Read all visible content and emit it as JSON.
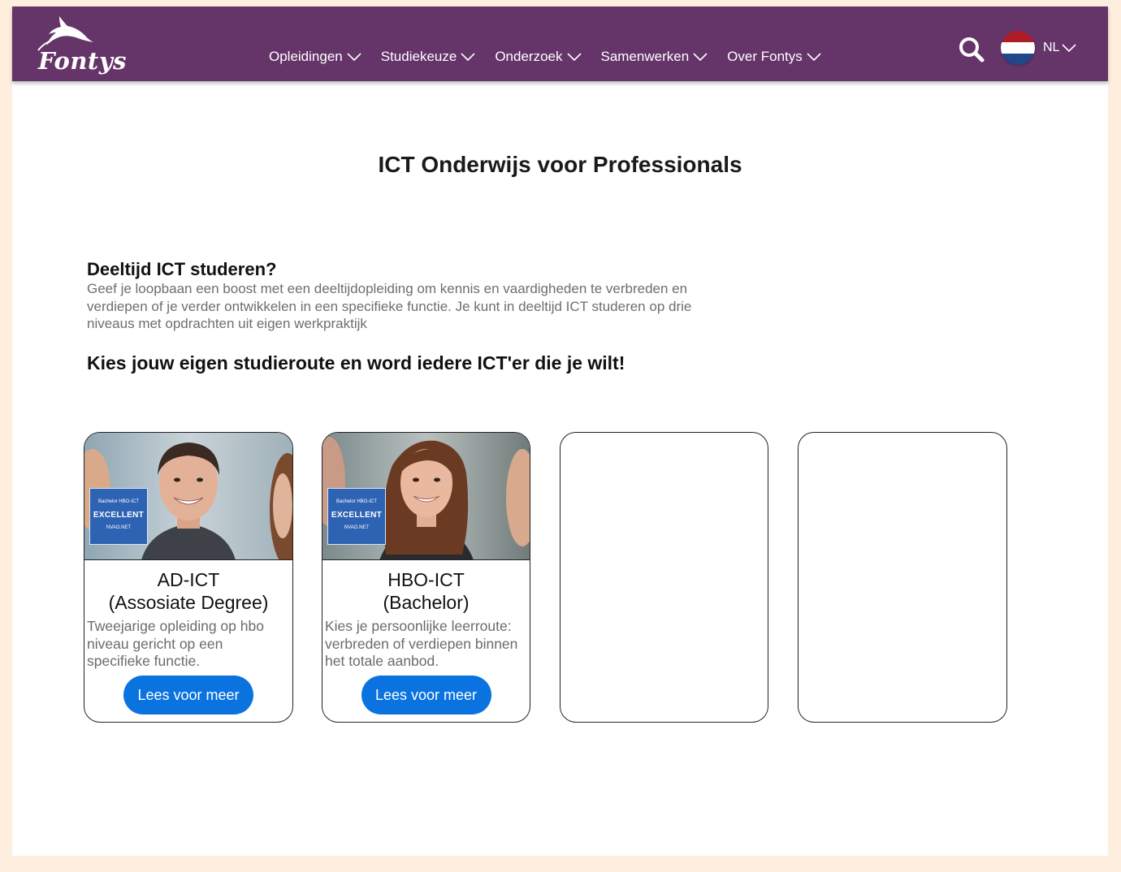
{
  "brand": {
    "name": "Fontys"
  },
  "nav": {
    "items": [
      {
        "label": "Opleidingen"
      },
      {
        "label": "Studiekeuze"
      },
      {
        "label": "Onderzoek"
      },
      {
        "label": "Samenwerken"
      },
      {
        "label": "Over Fontys"
      }
    ],
    "language": "NL"
  },
  "hero": {
    "title": "ICT Onderwijs voor Professionals"
  },
  "intro": {
    "heading": "Deeltijd ICT studeren?",
    "text": "Geef je loopbaan een boost met een deeltijdopleiding om kennis en vaardigheden te verbreden en verdiepen of je verder ontwikkelen in een specifieke functie. Je kunt in deeltijd ICT studeren op drie niveaus met opdrachten uit eigen werkpraktijk"
  },
  "route_heading": "Kies jouw eigen studieroute en word iedere ICT'er die je wilt!",
  "cards": [
    {
      "title_line1": "AD-ICT",
      "title_line2": "(Assosiate Degree)",
      "description": "Tweejarige opleiding op hbo niveau gericht op een specifieke functie.",
      "button": "Lees voor meer",
      "badge": {
        "line1": "Bachelor HBO-ICT",
        "line2": "EXCELLENT",
        "line3": "NVAO.NET"
      }
    },
    {
      "title_line1": "HBO-ICT",
      "title_line2": "(Bachelor)",
      "description": "Kies je persoonlijke leerroute: verbreden of verdiepen binnen het totale aanbod.",
      "button": "Lees voor meer",
      "badge": {
        "line1": "Bachelor HBO-ICT",
        "line2": "EXCELLENT",
        "line3": "NVAO.NET"
      }
    }
  ],
  "colors": {
    "navbar": "#653468",
    "page_background": "#fdeedd",
    "button": "#0a73e0",
    "badge": "#2e63b3"
  }
}
